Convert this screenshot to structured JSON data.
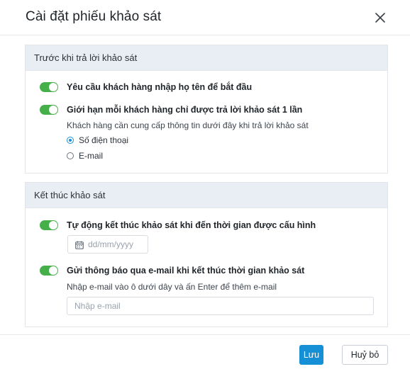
{
  "dialog": {
    "title": "Cài đặt phiếu khảo sát",
    "close_icon": "close-icon"
  },
  "section_before": {
    "heading": "Trước khi trả lời khảo sát",
    "require_name": {
      "label": "Yêu cầu khách hàng nhập họ tên để bắt đầu",
      "enabled": true
    },
    "limit_once": {
      "label": "Giới hạn mỗi khách hàng chỉ được trả lời khảo sát 1 lần",
      "enabled": true,
      "hint": "Khách hàng cần cung cấp thông tin dưới đây khi trả lời khảo sát",
      "options": [
        {
          "label": "Số điện thoại",
          "selected": true
        },
        {
          "label": "E-mail",
          "selected": false
        }
      ]
    }
  },
  "section_end": {
    "heading": "Kết thúc khảo sát",
    "auto_end": {
      "label": "Tự động kết thúc khảo sát khi đến thời gian được cấu hình",
      "enabled": true
    },
    "date_field": {
      "placeholder": "dd/mm/yyyy",
      "value": "",
      "icon": "calendar-icon"
    },
    "notify_email": {
      "label": "Gửi thông báo qua e-mail khi kết thúc thời gian khảo sát",
      "enabled": true,
      "hint": "Nhập e-mail vào ô dưới dây và ấn Enter để thêm e-mail",
      "placeholder": "Nhập e-mail",
      "value": ""
    }
  },
  "footer": {
    "save_label": "Lưu",
    "cancel_label": "Huỷ bỏ"
  },
  "colors": {
    "toggle_on": "#45b04a",
    "primary": "#1590d6",
    "section_header_bg": "#e9eef5"
  }
}
